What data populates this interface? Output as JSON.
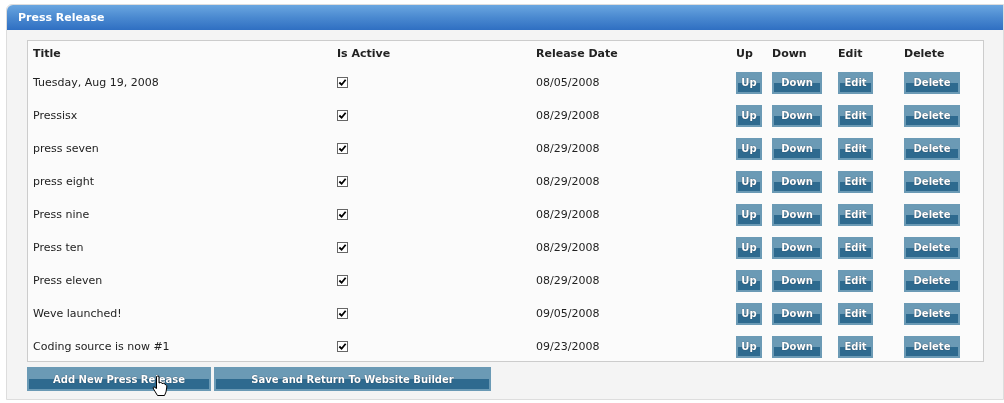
{
  "panel": {
    "title": "Press Release"
  },
  "table": {
    "columns": [
      "Title",
      "Is Active",
      "Release Date",
      "Up",
      "Down",
      "Edit",
      "Delete"
    ],
    "rows": [
      {
        "title": "Tuesday, Aug 19, 2008",
        "active": true,
        "date": "08/05/2008",
        "buttons": [
          "Up",
          "Down",
          "Edit",
          "Delete"
        ]
      },
      {
        "title": "Pressisx",
        "active": true,
        "date": "08/29/2008",
        "buttons": [
          "Up",
          "Down",
          "Edit",
          "Delete"
        ]
      },
      {
        "title": "press seven",
        "active": true,
        "date": "08/29/2008",
        "buttons": [
          "Up",
          "Down",
          "Edit",
          "Delete"
        ]
      },
      {
        "title": "press eight",
        "active": true,
        "date": "08/29/2008",
        "buttons": [
          "Up",
          "Down",
          "Edit",
          "Delete"
        ]
      },
      {
        "title": "Press nine",
        "active": true,
        "date": "08/29/2008",
        "buttons": [
          "Up",
          "Down",
          "Edit",
          "Delete"
        ]
      },
      {
        "title": "Press ten",
        "active": true,
        "date": "08/29/2008",
        "buttons": [
          "Up",
          "Down",
          "Edit",
          "Delete"
        ]
      },
      {
        "title": "Press eleven",
        "active": true,
        "date": "08/29/2008",
        "buttons": [
          "Up",
          "Down",
          "Edit",
          "Delete"
        ]
      },
      {
        "title": "Weve launched!",
        "active": true,
        "date": "09/05/2008",
        "buttons": [
          "Up",
          "Down",
          "Edit",
          "Delete"
        ]
      },
      {
        "title": "Coding source is now #1",
        "active": true,
        "date": "09/23/2008",
        "buttons": [
          "Up",
          "Down",
          "Edit",
          "Delete"
        ]
      }
    ]
  },
  "actions": [
    "Add New Press Release",
    "Save and Return To Website Builder"
  ]
}
